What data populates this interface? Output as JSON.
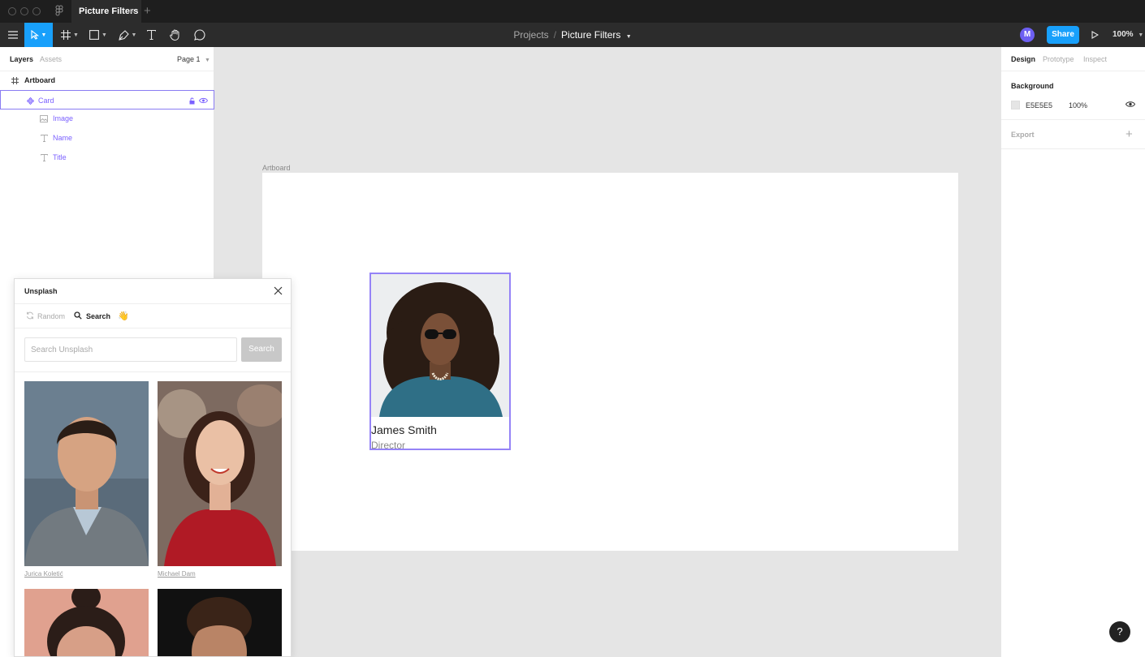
{
  "window": {
    "tab_title": "Picture Filters",
    "tab_close": "×",
    "tab_add": "+"
  },
  "toolbar": {
    "breadcrumb_projects": "Projects",
    "breadcrumb_sep": "/",
    "file_name": "Picture Filters",
    "avatar_initial": "M",
    "share_label": "Share",
    "zoom": "100%",
    "accent": "#18a0fb"
  },
  "layers_panel": {
    "tab_layers": "Layers",
    "tab_assets": "Assets",
    "page": "Page 1",
    "items": [
      {
        "label": "Artboard",
        "icon": "frame-icon"
      },
      {
        "label": "Card",
        "icon": "component-icon",
        "selected": true
      },
      {
        "label": "Image",
        "icon": "image-icon"
      },
      {
        "label": "Name",
        "icon": "text-icon"
      },
      {
        "label": "Title",
        "icon": "text-icon"
      }
    ]
  },
  "plugin": {
    "title": "Unsplash",
    "mode_random": "Random",
    "mode_search": "Search",
    "mode_wave": "👋",
    "search_placeholder": "Search Unsplash",
    "search_button": "Search",
    "photos": [
      {
        "credit": "Jurica Koletić"
      },
      {
        "credit": "Michael Dam"
      },
      {
        "credit": ""
      },
      {
        "credit": ""
      }
    ]
  },
  "canvas": {
    "artboard_label": "Artboard",
    "artboard_bg": "#ffffff",
    "card": {
      "name": "James Smith",
      "title": "Director",
      "selection_color": "#9583f7"
    }
  },
  "right_panel": {
    "tab_design": "Design",
    "tab_prototype": "Prototype",
    "tab_inspect": "Inspect",
    "background_title": "Background",
    "background_hex": "E5E5E5",
    "background_opacity": "100%",
    "export_title": "Export",
    "export_add": "+"
  },
  "help": "?"
}
